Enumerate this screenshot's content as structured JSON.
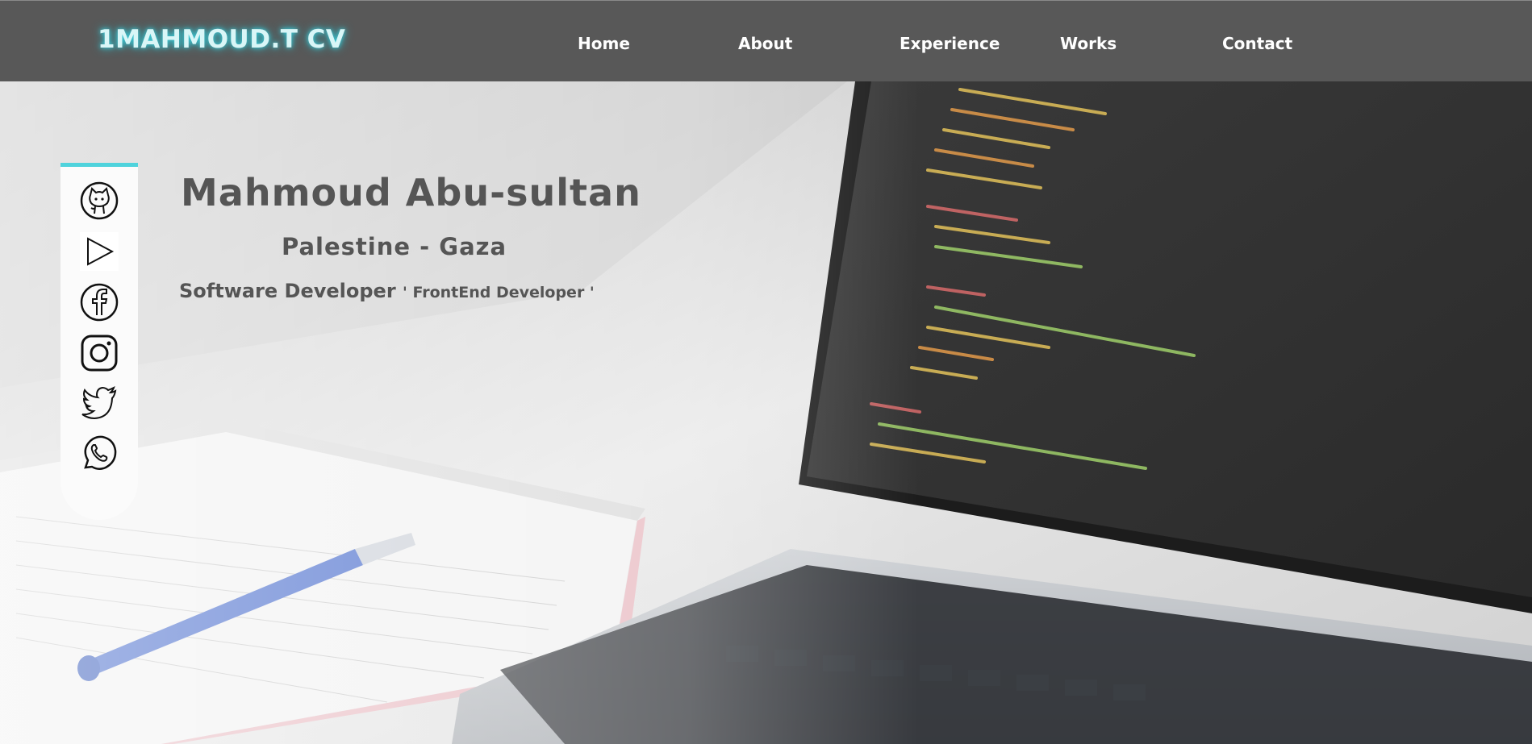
{
  "header": {
    "logo": "1MAHMOUD.T CV",
    "nav": [
      {
        "label": "Home"
      },
      {
        "label": "About"
      },
      {
        "label": "Experience"
      },
      {
        "label": "Works"
      },
      {
        "label": "Contact"
      }
    ]
  },
  "hero": {
    "name": "Mahmoud Abu-sultan",
    "location": "Palestine - Gaza",
    "role_main": "Software Developer",
    "role_sub": "' FrontEnd Developer '"
  },
  "social": [
    {
      "icon": "github-icon"
    },
    {
      "icon": "play-icon"
    },
    {
      "icon": "facebook-icon"
    },
    {
      "icon": "instagram-icon"
    },
    {
      "icon": "twitter-icon"
    },
    {
      "icon": "whatsapp-icon"
    }
  ],
  "colors": {
    "navbar": "#585858",
    "logo_glow": "#3fd3e0",
    "panel_accent": "#4fd3dc",
    "text": "#555555"
  }
}
